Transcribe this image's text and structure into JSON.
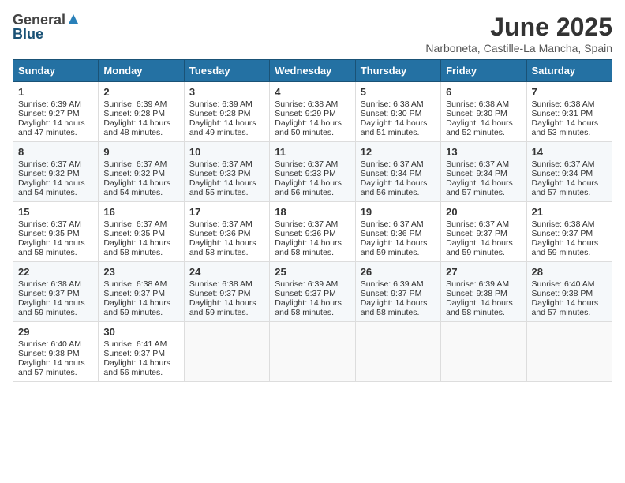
{
  "logo": {
    "general": "General",
    "blue": "Blue"
  },
  "title": "June 2025",
  "location": "Narboneta, Castille-La Mancha, Spain",
  "weekdays": [
    "Sunday",
    "Monday",
    "Tuesday",
    "Wednesday",
    "Thursday",
    "Friday",
    "Saturday"
  ],
  "weeks": [
    [
      {
        "day": 1,
        "rise": "6:39 AM",
        "set": "9:27 PM",
        "daylight": "14 hours and 47 minutes."
      },
      {
        "day": 2,
        "rise": "6:39 AM",
        "set": "9:28 PM",
        "daylight": "14 hours and 48 minutes."
      },
      {
        "day": 3,
        "rise": "6:39 AM",
        "set": "9:28 PM",
        "daylight": "14 hours and 49 minutes."
      },
      {
        "day": 4,
        "rise": "6:38 AM",
        "set": "9:29 PM",
        "daylight": "14 hours and 50 minutes."
      },
      {
        "day": 5,
        "rise": "6:38 AM",
        "set": "9:30 PM",
        "daylight": "14 hours and 51 minutes."
      },
      {
        "day": 6,
        "rise": "6:38 AM",
        "set": "9:30 PM",
        "daylight": "14 hours and 52 minutes."
      },
      {
        "day": 7,
        "rise": "6:38 AM",
        "set": "9:31 PM",
        "daylight": "14 hours and 53 minutes."
      }
    ],
    [
      {
        "day": 8,
        "rise": "6:37 AM",
        "set": "9:32 PM",
        "daylight": "14 hours and 54 minutes."
      },
      {
        "day": 9,
        "rise": "6:37 AM",
        "set": "9:32 PM",
        "daylight": "14 hours and 54 minutes."
      },
      {
        "day": 10,
        "rise": "6:37 AM",
        "set": "9:33 PM",
        "daylight": "14 hours and 55 minutes."
      },
      {
        "day": 11,
        "rise": "6:37 AM",
        "set": "9:33 PM",
        "daylight": "14 hours and 56 minutes."
      },
      {
        "day": 12,
        "rise": "6:37 AM",
        "set": "9:34 PM",
        "daylight": "14 hours and 56 minutes."
      },
      {
        "day": 13,
        "rise": "6:37 AM",
        "set": "9:34 PM",
        "daylight": "14 hours and 57 minutes."
      },
      {
        "day": 14,
        "rise": "6:37 AM",
        "set": "9:34 PM",
        "daylight": "14 hours and 57 minutes."
      }
    ],
    [
      {
        "day": 15,
        "rise": "6:37 AM",
        "set": "9:35 PM",
        "daylight": "14 hours and 58 minutes."
      },
      {
        "day": 16,
        "rise": "6:37 AM",
        "set": "9:35 PM",
        "daylight": "14 hours and 58 minutes."
      },
      {
        "day": 17,
        "rise": "6:37 AM",
        "set": "9:36 PM",
        "daylight": "14 hours and 58 minutes."
      },
      {
        "day": 18,
        "rise": "6:37 AM",
        "set": "9:36 PM",
        "daylight": "14 hours and 58 minutes."
      },
      {
        "day": 19,
        "rise": "6:37 AM",
        "set": "9:36 PM",
        "daylight": "14 hours and 59 minutes."
      },
      {
        "day": 20,
        "rise": "6:37 AM",
        "set": "9:37 PM",
        "daylight": "14 hours and 59 minutes."
      },
      {
        "day": 21,
        "rise": "6:38 AM",
        "set": "9:37 PM",
        "daylight": "14 hours and 59 minutes."
      }
    ],
    [
      {
        "day": 22,
        "rise": "6:38 AM",
        "set": "9:37 PM",
        "daylight": "14 hours and 59 minutes."
      },
      {
        "day": 23,
        "rise": "6:38 AM",
        "set": "9:37 PM",
        "daylight": "14 hours and 59 minutes."
      },
      {
        "day": 24,
        "rise": "6:38 AM",
        "set": "9:37 PM",
        "daylight": "14 hours and 59 minutes."
      },
      {
        "day": 25,
        "rise": "6:39 AM",
        "set": "9:37 PM",
        "daylight": "14 hours and 58 minutes."
      },
      {
        "day": 26,
        "rise": "6:39 AM",
        "set": "9:37 PM",
        "daylight": "14 hours and 58 minutes."
      },
      {
        "day": 27,
        "rise": "6:39 AM",
        "set": "9:38 PM",
        "daylight": "14 hours and 58 minutes."
      },
      {
        "day": 28,
        "rise": "6:40 AM",
        "set": "9:38 PM",
        "daylight": "14 hours and 57 minutes."
      }
    ],
    [
      {
        "day": 29,
        "rise": "6:40 AM",
        "set": "9:38 PM",
        "daylight": "14 hours and 57 minutes."
      },
      {
        "day": 30,
        "rise": "6:41 AM",
        "set": "9:37 PM",
        "daylight": "14 hours and 56 minutes."
      },
      null,
      null,
      null,
      null,
      null
    ]
  ]
}
